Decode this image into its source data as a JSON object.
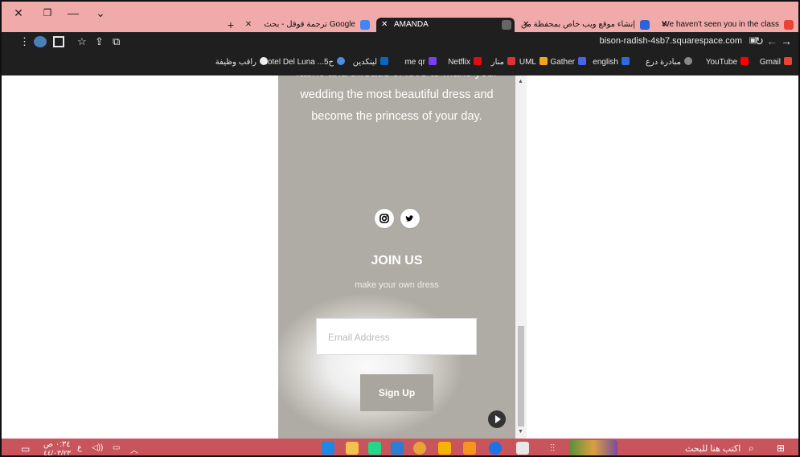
{
  "window": {
    "close": "✕",
    "restore": "❐",
    "minimize": "—",
    "dropdown": "⌄",
    "new_tab": "+",
    "separator_close": "✕"
  },
  "tabs": [
    {
      "label": "ترجمة قوقل - بحث Google",
      "active": false,
      "icon_color": "#4285f4",
      "icon": "google-icon"
    },
    {
      "label": "AMANDA",
      "active": true,
      "icon_color": "#666666",
      "icon": "squarespace-icon"
    },
    {
      "label": "إنشاء موقع ويب خاص بمحفظة من",
      "active": false,
      "icon_color": "#2b64d9",
      "icon": "site-builder-icon"
    },
    {
      "label": "We haven't seen you in the class",
      "active": false,
      "icon_color": "#ea4335",
      "icon": "gmail-icon"
    }
  ],
  "address": {
    "url": "bison-radish-4sb7.squarespace.com",
    "lock": "🔒",
    "reload": "↻",
    "back": "←",
    "forward": "→",
    "menu": "⋮",
    "star": "☆"
  },
  "bookmarks": [
    {
      "label": "Gmail",
      "color": "#ea4335"
    },
    {
      "label": "YouTube",
      "color": "#ff0000"
    },
    {
      "label": "مبادرة درع",
      "color": "#888888"
    },
    {
      "label": "english",
      "color": "#2b6cd9"
    },
    {
      "label": "Gather",
      "color": "#4a63e8"
    },
    {
      "label": "UML",
      "color": "#f7a21b"
    },
    {
      "label": "منار",
      "color": "#d33"
    },
    {
      "label": "Netflix",
      "color": "#e50914"
    },
    {
      "label": "me qr",
      "color": "#7a3ff0"
    },
    {
      "label": "لينكدين",
      "color": "#0a66c2"
    },
    {
      "label": "Hotel Del Luna ...5ح",
      "color": "#4a90e2"
    },
    {
      "label": "راقب وظيفة",
      "color": "#eeeeee"
    }
  ],
  "page": {
    "body_text": "fabric and threads of love to make your wedding the most beautiful dress and become the princess of your day.",
    "join_title": "JOIN US",
    "join_subtitle": "make your own dress",
    "email_placeholder": "Email Address",
    "signup_label": "Sign Up"
  },
  "taskbar": {
    "search_placeholder": "اكتب هنا للبحث",
    "time": "٠:٣٤ ص",
    "date": "٤٤/٠٣/٢٣",
    "lang": "ع"
  }
}
